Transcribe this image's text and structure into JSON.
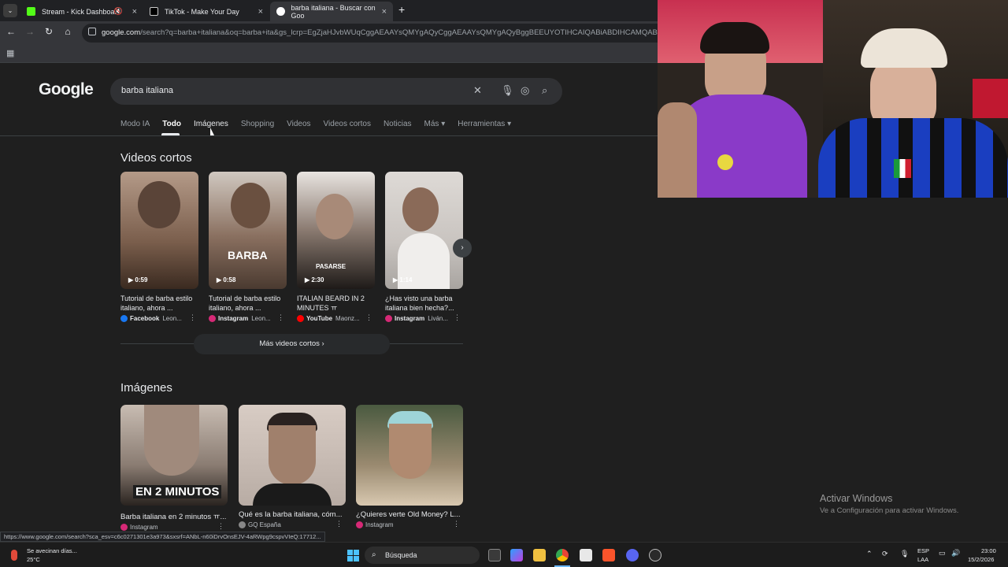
{
  "browser": {
    "tabs": [
      {
        "title": "Stream - Kick Dashboard",
        "favicon_color": "#53fc18"
      },
      {
        "title": "TikTok - Make Your Day",
        "favicon_color": "#ffffff"
      },
      {
        "title": "barba italiana - Buscar con Goo",
        "favicon_color": "#4285f4"
      }
    ],
    "address": {
      "host": "google.com",
      "path": "/search?q=barba+italiana&oq=barba+ita&gs_lcrp=EgZjaHJvbWUqCggAEAAYsQMYgAQyCggAEAAYsQMYgAQyBggBEEUYOTIHCAIQABiABDIHCAMQABiABDIHCAQ"
    }
  },
  "google": {
    "logo": "Google",
    "query": "barba italiana",
    "tabs": [
      "Modo IA",
      "Todo",
      "Imágenes",
      "Shopping",
      "Videos",
      "Videos cortos",
      "Noticias",
      "Más",
      "Herramientas"
    ],
    "short_videos": {
      "heading": "Videos cortos",
      "items": [
        {
          "duration": "0:59",
          "title": "Tutorial de barba estilo italiano, ahora ...",
          "source": "Facebook",
          "author": "Leon...",
          "thumb_color": "#7a5e4c",
          "source_color": "#1877f2",
          "overlay": ""
        },
        {
          "duration": "0:58",
          "title": "Tutorial de barba estilo italiano, ahora ...",
          "source": "Instagram",
          "author": "Leon...",
          "thumb_color": "#6b5648",
          "source_color": "#d62976",
          "overlay": "BARBA"
        },
        {
          "duration": "2:30",
          "title": "ITALIAN BEARD IN 2 MINUTES ㅠ",
          "source": "YouTube",
          "author": "Maonz...",
          "thumb_color": "#3a3430",
          "source_color": "#ff0000",
          "overlay": "PASARSE"
        },
        {
          "duration": "1:14",
          "title": "¿Has visto una barba italiana bien hecha?...",
          "source": "Instagram",
          "author": "Liván...",
          "thumb_color": "#c9c4c0",
          "source_color": "#d62976",
          "overlay": ""
        }
      ],
      "more_button": "Más videos cortos"
    },
    "images": {
      "heading": "Imágenes",
      "items": [
        {
          "title": "Barba italiana en 2 minutos ㅠ...",
          "source": "Instagram",
          "thumb_color": "#8a7c72",
          "source_color": "#d62976",
          "overlay": "EN 2 MINUTOS"
        },
        {
          "title": "Qué es la barba italiana, cóm...",
          "source": "GQ España",
          "thumb_color": "#b8aca4",
          "source_color": "#888888",
          "overlay": ""
        },
        {
          "title": "¿Quieres verte Old Money? L...",
          "source": "Instagram",
          "thumb_color": "#9a8a70",
          "source_color": "#d62976",
          "overlay": ""
        }
      ]
    }
  },
  "watermark": {
    "line1": "Activar Windows",
    "line2": "Ve a Configuración para activar Windows."
  },
  "status_url": "https://www.google.com/search?sca_esv=c6c0271301e3a973&sxsrf=ANbL-n60iDrvOnsEJV-4aRWpg9cspvVIeQ:17712...",
  "taskbar": {
    "weather_line1": "Se avecinan días...",
    "weather_line2": "25°C",
    "search_label": "Búsqueda",
    "lang1": "ESP",
    "lang2": "LAA",
    "time": "23:00",
    "date": "15/2/2026"
  }
}
